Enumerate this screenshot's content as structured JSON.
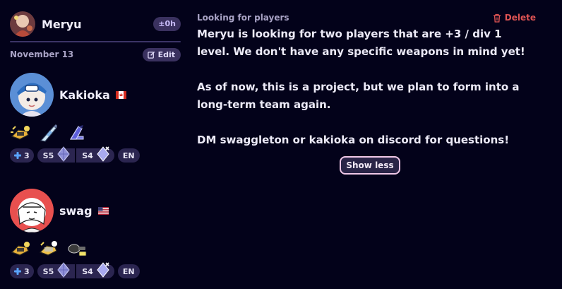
{
  "team": {
    "name": "Meryu",
    "time_badge": "±0h",
    "date": "November 13",
    "edit_label": "Edit",
    "avatar_icon": "team-avatar-icon"
  },
  "players": [
    {
      "name": "Kakioka",
      "flag": "canada-flag-icon",
      "weapons": [
        "weapon-icon",
        "weapon-icon",
        "weapon-icon"
      ],
      "plus_tier": "3",
      "seasons": [
        {
          "label": "S5"
        },
        {
          "label": "S4"
        }
      ],
      "language": "EN"
    },
    {
      "name": "swag",
      "flag": "usa-flag-icon",
      "weapons": [
        "weapon-icon",
        "weapon-icon",
        "weapon-icon"
      ],
      "plus_tier": "3",
      "seasons": [
        {
          "label": "S5"
        },
        {
          "label": "S4"
        }
      ],
      "language": "EN"
    }
  ],
  "post": {
    "heading": "Looking for players",
    "delete_label": "Delete",
    "description": "Meryu is looking for two players that are +3 / div 1 level. We don't have any specific weapons in mind yet!\n\nAs of now, this is a project, but we plan to form into a long-term team again.\n\nDM swaggleton or kakioka on discord for questions!",
    "toggle_label": "Show less"
  },
  "colors": {
    "background": "#03021a",
    "pill": "#3a315f",
    "delete": "#e05454",
    "toggle_border": "#f0c8e8"
  }
}
